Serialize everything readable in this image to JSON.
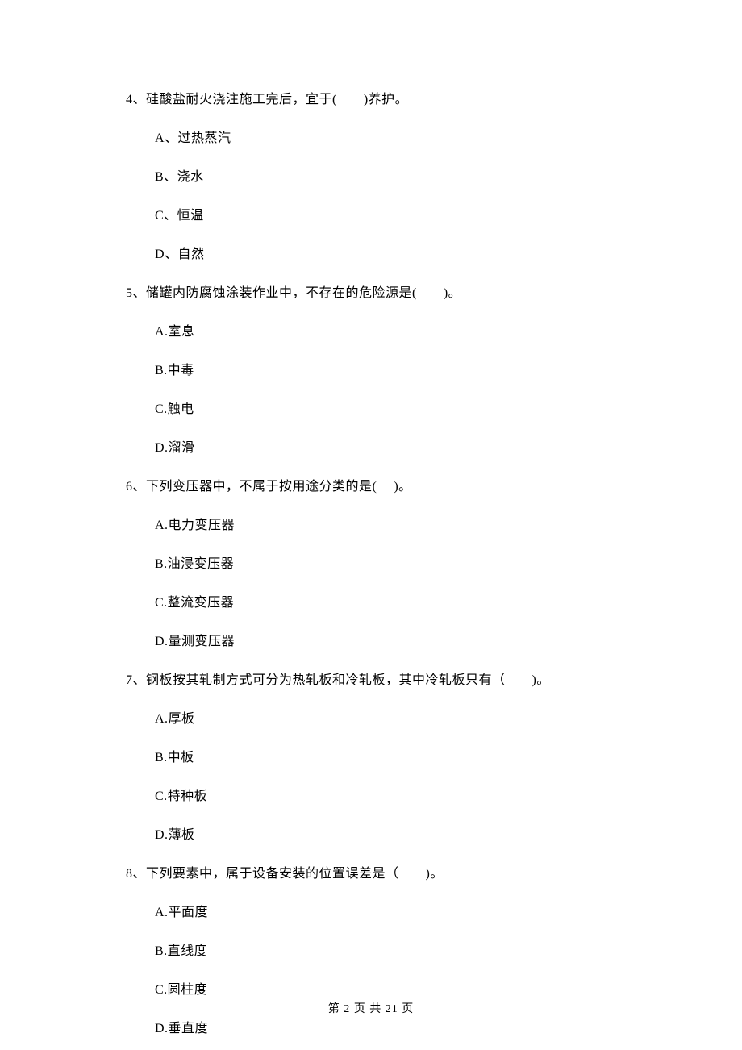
{
  "questions": [
    {
      "stem": "4、硅酸盐耐火浇注施工完后，宜于(　　)养护。",
      "options": [
        "A、过热蒸汽",
        "B、浇水",
        "C、恒温",
        "D、自然"
      ]
    },
    {
      "stem": "5、储罐内防腐蚀涂装作业中，不存在的危险源是(　　)。",
      "options": [
        "A.室息",
        "B.中毒",
        "C.触电",
        "D.溜滑"
      ]
    },
    {
      "stem": "6、下列变压器中，不属于按用途分类的是(　 )。",
      "options": [
        "A.电力变压器",
        "B.油浸变压器",
        "C.整流变压器",
        "D.量测变压器"
      ]
    },
    {
      "stem": "7、钢板按其轧制方式可分为热轧板和冷轧板，其中冷轧板只有（　　)。",
      "options": [
        "A.厚板",
        "B.中板",
        "C.特种板",
        "D.薄板"
      ]
    },
    {
      "stem": "8、下列要素中，属于设备安装的位置误差是（　　)。",
      "options": [
        "A.平面度",
        "B.直线度",
        "C.圆柱度",
        "D.垂直度"
      ]
    }
  ],
  "footer": "第 2 页 共 21 页"
}
